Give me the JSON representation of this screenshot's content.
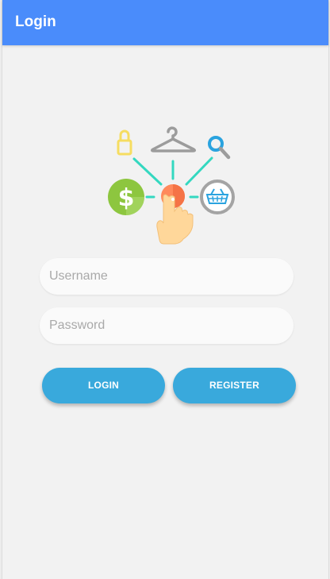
{
  "appbar": {
    "title": "Login",
    "color": "#4a8cfb"
  },
  "hero": {
    "icons": [
      "lock-icon",
      "hanger-icon",
      "search-icon",
      "dollar-coin-icon",
      "touch-hand-icon",
      "shopping-basket-icon"
    ]
  },
  "form": {
    "username_placeholder": "Username",
    "password_placeholder": "Password"
  },
  "buttons": {
    "login_label": "LOGIN",
    "register_label": "REGISTER",
    "color": "#39a9dc"
  }
}
